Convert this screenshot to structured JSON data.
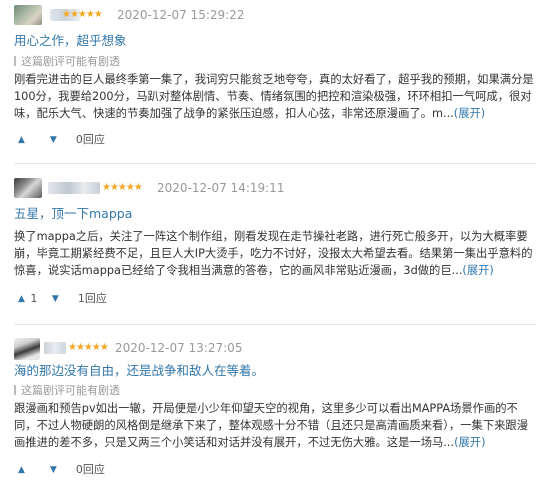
{
  "reviews": [
    {
      "stars": "★★★★★",
      "time": "2020-12-07 15:29:22",
      "title": "用心之作，超乎想象",
      "spoiler": "这篇剧评可能有剧透",
      "body": "刚看完进击的巨人最终季第一集了，我词穷只能贫乏地夸夸，真的太好看了，超乎我的预期，如果满分是100分，我要给200分，马趴对整体剧情、节奏、情绪氛围的把控和渲染极强，环环相扣一气呵成，很对味，配乐大气、快速的节奏加强了战争的紧张压迫感，扣人心弦，非常还原漫画了。m...",
      "expand": "(展开)",
      "up": "",
      "down": "",
      "reply": "0回应"
    },
    {
      "stars": "★★★★★",
      "time": "2020-12-07 14:19:11",
      "title": "五星，顶一下mappa",
      "spoiler": "",
      "body": "换了mappa之后，关注了一阵这个制作组，刚看发现在走节操社老路，进行死亡般多开，以为大概率要崩，毕竟工期紧经费不足，且巨人大IP大烫手，吃力不讨好，没报太大希望去看。结果第一集出乎意料的惊喜，说实话mappa已经给了令我相当满意的答卷，它的画风非常贴近漫画，3d做的巨...",
      "expand": "(展开)",
      "up": "1",
      "down": "",
      "reply": "1回应"
    },
    {
      "stars": "★★★★★",
      "time": "2020-12-07 13:27:05",
      "title": "海的那边没有自由，还是战争和敌人在等着。",
      "spoiler": "这篇剧评可能有剧透",
      "body": "跟漫画和预告pv如出一辙，开局便是小少年仰望天空的视角，这里多少可以看出MAPPA场景作画的不同，不过人物硬朗的风格倒是继承下来了，整体观感十分不错（且还只是高清画质来看），一集下来跟漫画推进的差不多，只是又两三个小笑话和对话并没有展开，不过无伤大雅。这是一场马...",
      "expand": "(展开)",
      "up": "",
      "down": "",
      "reply": "0回应"
    }
  ]
}
